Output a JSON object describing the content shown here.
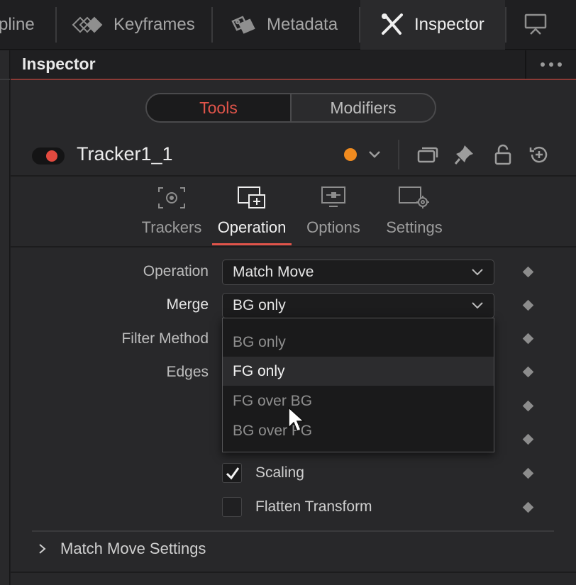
{
  "top_tabs": [
    {
      "label": "pline",
      "icon": "spline-icon"
    },
    {
      "label": "Keyframes",
      "icon": "keyframes-icon"
    },
    {
      "label": "Metadata",
      "icon": "metadata-tag-icon"
    },
    {
      "label": "Inspector",
      "icon": "inspector-tools-icon"
    },
    {
      "label": "",
      "icon": "viewer-icon"
    }
  ],
  "panel": {
    "title": "Inspector"
  },
  "segmented": {
    "tools": "Tools",
    "modifiers": "Modifiers"
  },
  "node": {
    "name": "Tracker1_1",
    "color_dot": "#f08b1f",
    "toggle_color": "#e34a3f"
  },
  "sub_tabs": [
    {
      "label": "Trackers",
      "icon": "trackers-icon"
    },
    {
      "label": "Operation",
      "icon": "operation-icon",
      "active": true
    },
    {
      "label": "Options",
      "icon": "options-icon"
    },
    {
      "label": "Settings",
      "icon": "settings-icon"
    }
  ],
  "form": {
    "operation_label": "Operation",
    "operation_value": "Match Move",
    "merge_label": "Merge",
    "merge_value": "BG only",
    "filter_label": "Filter Method",
    "edges_label": "Edges"
  },
  "merge_options": [
    "BG only",
    "FG only",
    "FG over BG",
    "BG over FG"
  ],
  "hovered_option": "FG only",
  "checkboxes": [
    {
      "label": "Scaling",
      "checked": true
    },
    {
      "label": "Flatten Transform",
      "checked": false
    }
  ],
  "section": {
    "label": "Match Move Settings"
  },
  "colors": {
    "accent": "#e0544a",
    "panel_bg": "#28282a"
  }
}
